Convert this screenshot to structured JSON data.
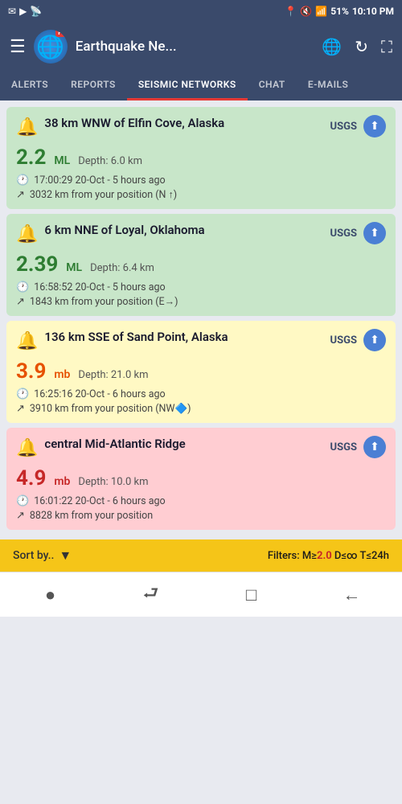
{
  "statusBar": {
    "leftIcons": [
      "✉",
      "▶",
      "📶"
    ],
    "battery": "51%",
    "time": "10:10 PM",
    "signalIcon": "📶"
  },
  "header": {
    "title": "Earthquake Ne...",
    "menuIcon": "☰",
    "globeIcon": "🌐",
    "refreshIcon": "↻",
    "expandIcon": "⛶",
    "proBadge": "Pro"
  },
  "tabs": [
    {
      "id": "alerts",
      "label": "ALERTS",
      "active": false
    },
    {
      "id": "reports",
      "label": "REPORTS",
      "active": false
    },
    {
      "id": "seismic",
      "label": "SEISMIC NETWORKS",
      "active": true
    },
    {
      "id": "chat",
      "label": "CHAT",
      "active": false
    },
    {
      "id": "emails",
      "label": "E-MAILS",
      "active": false
    }
  ],
  "earthquakes": [
    {
      "id": "quake-1",
      "color": "green",
      "title": "38 km WNW of Elfin Cove, Alaska",
      "magnitude": "2.2",
      "magnitudeType": "ML",
      "depth": "Depth: 6.0 km",
      "time": "17:00:29 20-Oct - 5 hours ago",
      "distance": "3032 km from your position (N ↑)",
      "source": "USGS"
    },
    {
      "id": "quake-2",
      "color": "green",
      "title": "6 km NNE of Loyal, Oklahoma",
      "magnitude": "2.39",
      "magnitudeType": "ML",
      "depth": "Depth: 6.4 km",
      "time": "16:58:52 20-Oct - 5 hours ago",
      "distance": "1843 km from your position (E→)",
      "source": "USGS"
    },
    {
      "id": "quake-3",
      "color": "yellow",
      "title": "136 km SSE of Sand Point, Alaska",
      "magnitude": "3.9",
      "magnitudeType": "mb",
      "depth": "Depth: 21.0 km",
      "time": "16:25:16 20-Oct - 6 hours ago",
      "distance": "3910 km from your position (NW🔷)",
      "source": "USGS"
    },
    {
      "id": "quake-4",
      "color": "red",
      "title": "central Mid-Atlantic Ridge",
      "magnitude": "4.9",
      "magnitudeType": "mb",
      "depth": "Depth: 10.0 km",
      "time": "16:01:22 20-Oct - 6 hours ago",
      "distance": "8828 km from your position",
      "source": "USGS"
    }
  ],
  "bottomBar": {
    "sortLabel": "Sort by..",
    "filterLabel": "Filters: M≥",
    "filterMag": "2.0",
    "filterExtra": " D≤∞ T≤24h"
  },
  "navBar": {
    "items": [
      "●",
      "⮐",
      "□",
      "←"
    ]
  }
}
